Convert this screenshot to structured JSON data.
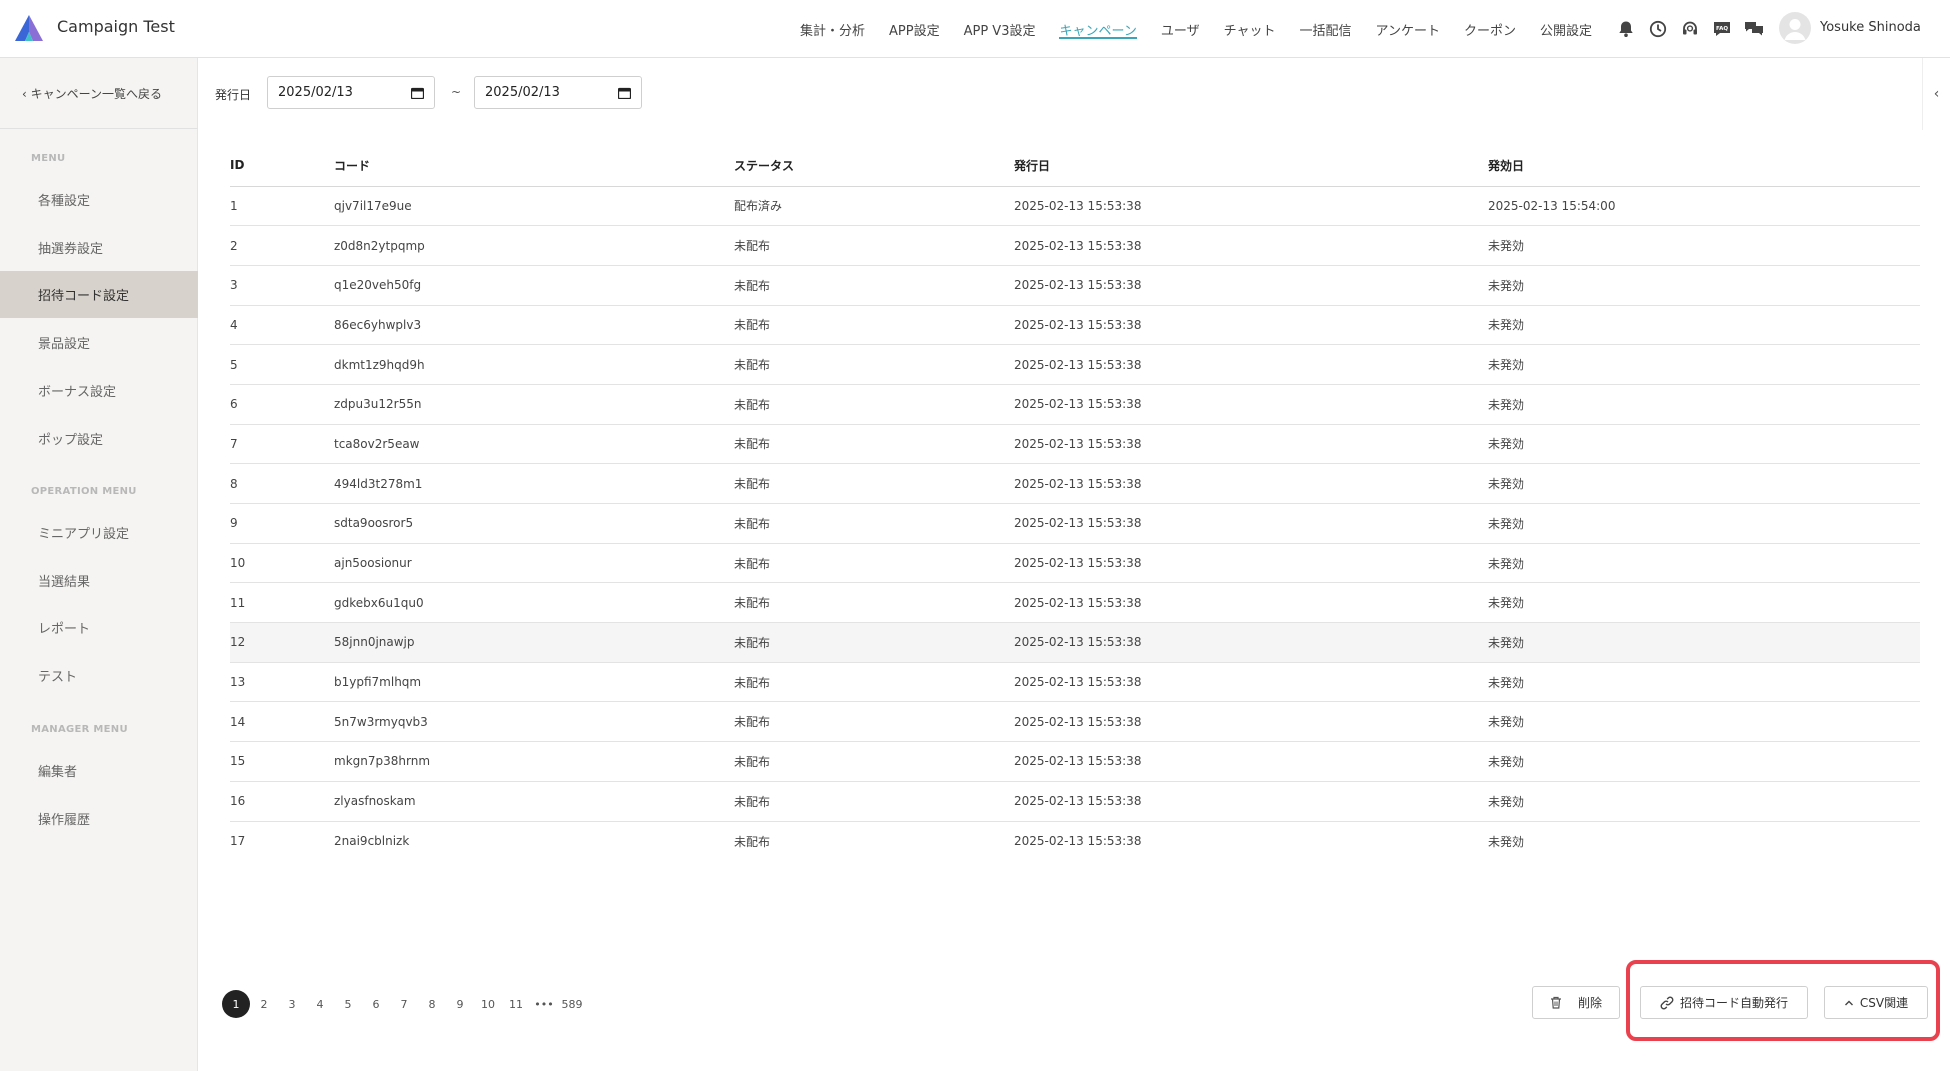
{
  "app": {
    "title": "Campaign Test"
  },
  "nav": [
    {
      "label": "集計・分析",
      "active": false
    },
    {
      "label": "APP設定",
      "active": false
    },
    {
      "label": "APP V3設定",
      "active": false
    },
    {
      "label": "キャンペーン",
      "active": true
    },
    {
      "label": "ユーザ",
      "active": false
    },
    {
      "label": "チャット",
      "active": false
    },
    {
      "label": "一括配信",
      "active": false
    },
    {
      "label": "アンケート",
      "active": false
    },
    {
      "label": "クーポン",
      "active": false
    },
    {
      "label": "公開設定",
      "active": false
    }
  ],
  "user": {
    "name": "Yosuke Shinoda"
  },
  "sidebar": {
    "back_label": "キャンペーン一覧へ戻る",
    "sections": [
      {
        "heading": "MENU",
        "items": [
          "各種設定",
          "抽選券設定",
          "招待コード設定",
          "景品設定",
          "ボーナス設定",
          "ポップ設定"
        ]
      },
      {
        "heading": "OPERATION MENU",
        "items": [
          "ミニアプリ設定",
          "当選結果",
          "レポート",
          "テスト"
        ]
      },
      {
        "heading": "MANAGER MENU",
        "items": [
          "編集者",
          "操作履歴"
        ]
      }
    ],
    "active_item": "招待コード設定"
  },
  "filter": {
    "label": "発行日",
    "date_from": "2025/02/13",
    "separator": "~",
    "date_to": "2025/02/13"
  },
  "table": {
    "columns": [
      "ID",
      "コード",
      "ステータス",
      "発行日",
      "発効日"
    ],
    "rows": [
      [
        "1",
        "qjv7il17e9ue",
        "配布済み",
        "2025-02-13 15:53:38",
        "2025-02-13 15:54:00"
      ],
      [
        "2",
        "z0d8n2ytpqmp",
        "未配布",
        "2025-02-13 15:53:38",
        "未発効"
      ],
      [
        "3",
        "q1e20veh50fg",
        "未配布",
        "2025-02-13 15:53:38",
        "未発効"
      ],
      [
        "4",
        "86ec6yhwplv3",
        "未配布",
        "2025-02-13 15:53:38",
        "未発効"
      ],
      [
        "5",
        "dkmt1z9hqd9h",
        "未配布",
        "2025-02-13 15:53:38",
        "未発効"
      ],
      [
        "6",
        "zdpu3u12r55n",
        "未配布",
        "2025-02-13 15:53:38",
        "未発効"
      ],
      [
        "7",
        "tca8ov2r5eaw",
        "未配布",
        "2025-02-13 15:53:38",
        "未発効"
      ],
      [
        "8",
        "494ld3t278m1",
        "未配布",
        "2025-02-13 15:53:38",
        "未発効"
      ],
      [
        "9",
        "sdta9oosror5",
        "未配布",
        "2025-02-13 15:53:38",
        "未発効"
      ],
      [
        "10",
        "ajn5oosionur",
        "未配布",
        "2025-02-13 15:53:38",
        "未発効"
      ],
      [
        "11",
        "gdkebx6u1qu0",
        "未配布",
        "2025-02-13 15:53:38",
        "未発効"
      ],
      [
        "12",
        "58jnn0jnawjp",
        "未配布",
        "2025-02-13 15:53:38",
        "未発効"
      ],
      [
        "13",
        "b1ypfi7mlhqm",
        "未配布",
        "2025-02-13 15:53:38",
        "未発効"
      ],
      [
        "14",
        "5n7w3rmyqvb3",
        "未配布",
        "2025-02-13 15:53:38",
        "未発効"
      ],
      [
        "15",
        "mkgn7p38hrnm",
        "未配布",
        "2025-02-13 15:53:38",
        "未発効"
      ],
      [
        "16",
        "zlyasfnoskam",
        "未配布",
        "2025-02-13 15:53:38",
        "未発効"
      ],
      [
        "17",
        "2nai9cblnizk",
        "未配布",
        "2025-02-13 15:53:38",
        "未発効"
      ]
    ],
    "highlighted_row": 12
  },
  "pagination": {
    "pages": [
      "1",
      "2",
      "3",
      "4",
      "5",
      "6",
      "7",
      "8",
      "9",
      "10",
      "11"
    ],
    "ellipsis": "•••",
    "last": "589",
    "current": "1"
  },
  "actions": {
    "delete_label": "削除",
    "auto_issue_label": "招待コード自動発行",
    "csv_label": "CSV関連"
  },
  "icons": [
    "bell-icon",
    "clock-icon",
    "headset-icon",
    "faq-icon",
    "chat-icon"
  ],
  "colors": {
    "accent": "#3aa5b8",
    "highlight_border": "#e9424e",
    "sidebar_active": "#d7d2cb"
  }
}
